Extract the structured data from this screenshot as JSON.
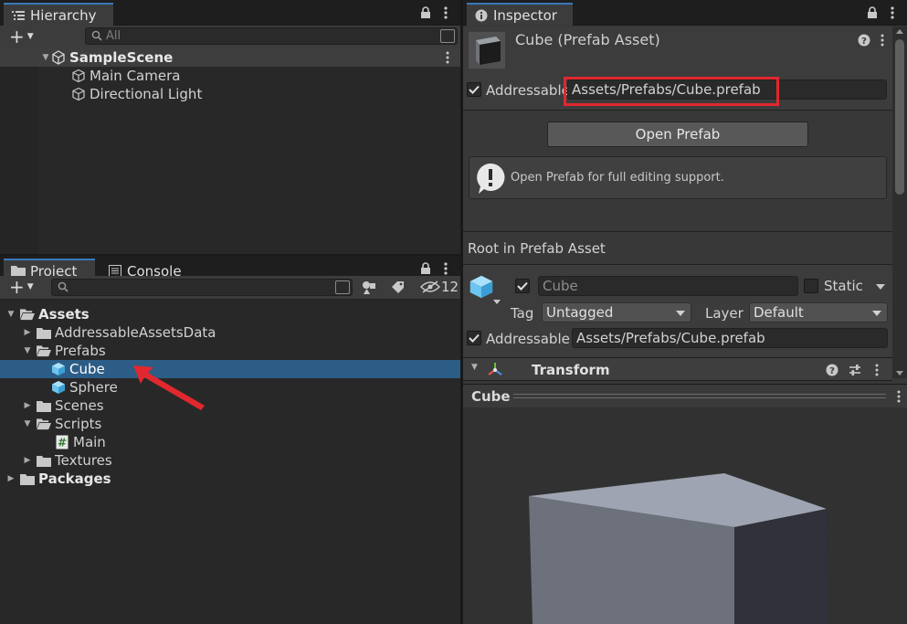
{
  "hierarchy": {
    "tab_label": "Hierarchy",
    "search_placeholder": "All",
    "scene_name": "SampleScene",
    "items": [
      "Main Camera",
      "Directional Light"
    ]
  },
  "project": {
    "tab_label": "Project",
    "console_tab_label": "Console",
    "hidden_count": "12",
    "tree": {
      "assets": "Assets",
      "addressable_data": "AddressableAssetsData",
      "prefabs": "Prefabs",
      "cube": "Cube",
      "sphere": "Sphere",
      "scenes": "Scenes",
      "scripts": "Scripts",
      "main": "Main",
      "textures": "Textures",
      "packages": "Packages"
    }
  },
  "inspector": {
    "tab_label": "Inspector",
    "asset_title": "Cube (Prefab Asset)",
    "addressable_label": "Addressable",
    "addressable_path": "Assets/Prefabs/Cube.prefab",
    "open_prefab_label": "Open Prefab",
    "help_text": "Open Prefab for full editing support.",
    "root_header": "Root in Prefab Asset",
    "object_name": "Cube",
    "static_label": "Static",
    "tag_label": "Tag",
    "tag_value": "Untagged",
    "layer_label": "Layer",
    "layer_value": "Default",
    "addressable_label_2": "Addressable",
    "addressable_path_2": "Assets/Prefabs/Cube.prefab",
    "transform_label": "Transform",
    "preview_title": "Cube"
  },
  "colors": {
    "selection": "#2c5d87",
    "highlight_box": "#e0282e",
    "annotation_arrow": "#e0282e",
    "prefab_icon": "#6cc4f0"
  }
}
